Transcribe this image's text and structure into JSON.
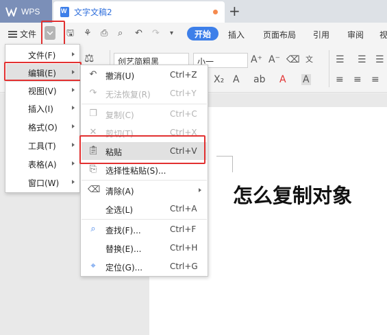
{
  "titlebar": {
    "app_name": "WPS",
    "document_tab": "文字文稿2",
    "new_tab_symbol": "+"
  },
  "ribbon": {
    "file_menu_label": "文件",
    "tabs": [
      "开始",
      "插入",
      "页面布局",
      "引用",
      "审阅",
      "视"
    ],
    "active_tab": "开始"
  },
  "toolbar": {
    "font_name": "创艺简粗黑",
    "font_size": "小一"
  },
  "document": {
    "heading": "怎么复制对象"
  },
  "main_menu": {
    "items": [
      {
        "label": "文件(F)"
      },
      {
        "label": "编辑(E)"
      },
      {
        "label": "视图(V)"
      },
      {
        "label": "插入(I)"
      },
      {
        "label": "格式(O)"
      },
      {
        "label": "工具(T)"
      },
      {
        "label": "表格(A)"
      },
      {
        "label": "窗口(W)"
      }
    ],
    "active_index": 1
  },
  "edit_menu": {
    "items": [
      {
        "label": "撤消(U)",
        "shortcut": "Ctrl+Z",
        "icon": "undo-icon"
      },
      {
        "label": "无法恢复(R)",
        "shortcut": "Ctrl+Y",
        "icon": "redo-icon",
        "disabled": true
      },
      {
        "label": "复制(C)",
        "shortcut": "Ctrl+C",
        "icon": "copy-icon",
        "disabled": true
      },
      {
        "label": "剪切(T)",
        "shortcut": "Ctrl+X",
        "icon": "cut-icon",
        "disabled": true
      },
      {
        "label": "粘贴",
        "shortcut": "Ctrl+V",
        "icon": "paste-icon",
        "active": true
      },
      {
        "label": "选择性粘贴(S)...",
        "shortcut": "",
        "icon": "paste-special-icon"
      },
      {
        "label": "清除(A)",
        "shortcut": "",
        "icon": "eraser-icon"
      },
      {
        "label": "全选(L)",
        "shortcut": "Ctrl+A",
        "icon": ""
      },
      {
        "label": "查找(F)...",
        "shortcut": "Ctrl+F",
        "icon": "search-icon"
      },
      {
        "label": "替换(E)...",
        "shortcut": "Ctrl+H",
        "icon": ""
      },
      {
        "label": "定位(G)...",
        "shortcut": "Ctrl+G",
        "icon": "locate-icon"
      }
    ]
  },
  "colors": {
    "accent": "#3d7fe9",
    "highlight_border": "#e23030",
    "wps_tab": "#7b8fb8"
  }
}
